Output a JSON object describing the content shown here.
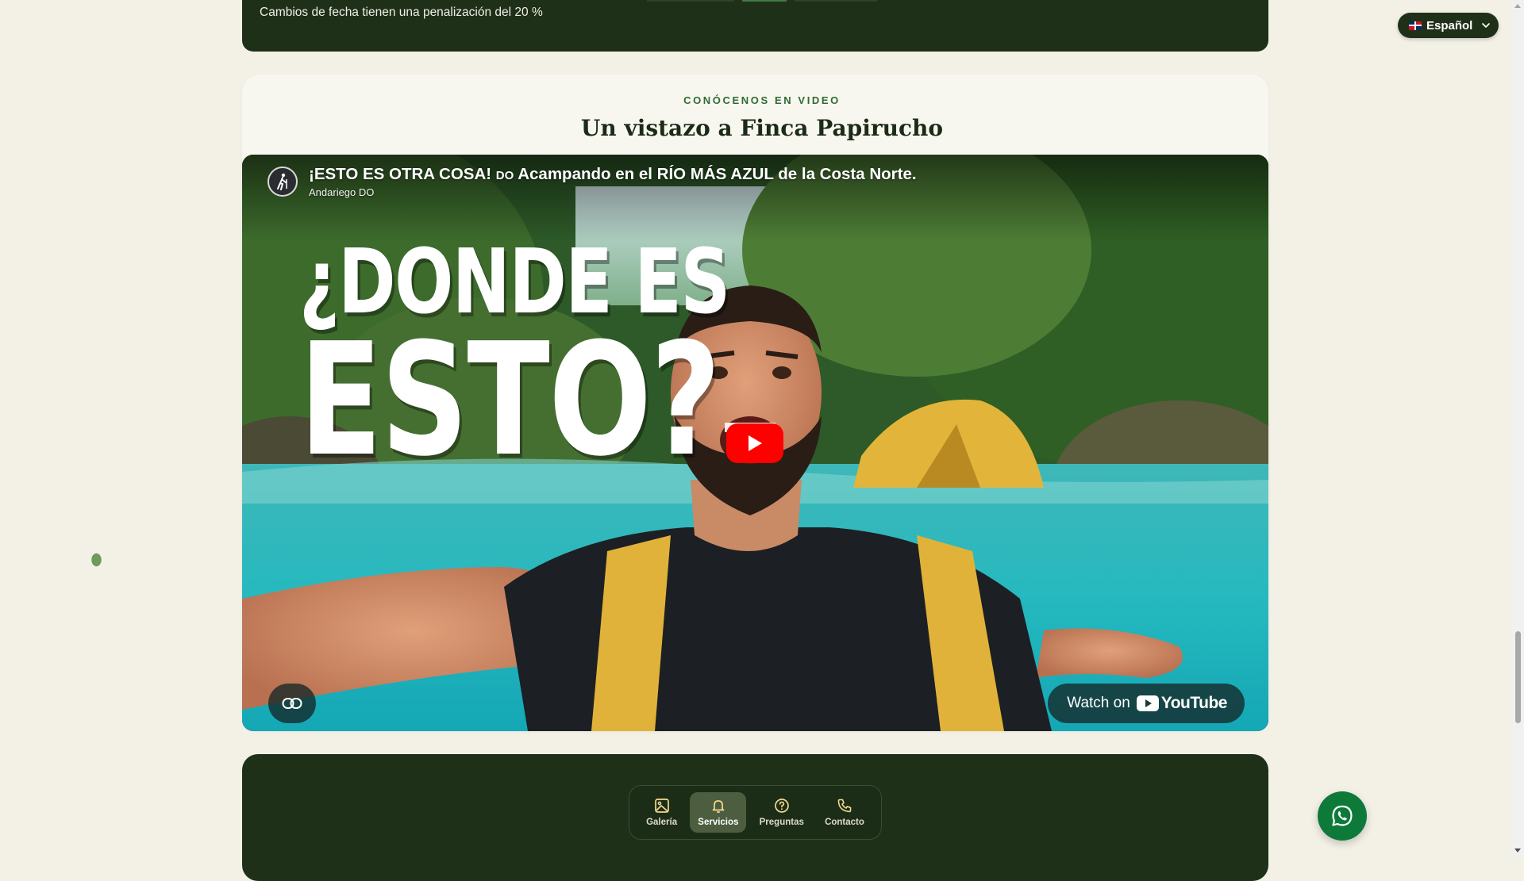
{
  "previous_section": {
    "note": "Cambios de fecha tienen una penalización del 20 %"
  },
  "video_section": {
    "eyebrow": "CONÓCENOS EN VIDEO",
    "title": "Un vistazo a Finca Papirucho"
  },
  "video": {
    "title_part1": "¡ESTO ES OTRA COSA! ",
    "title_flag": "DO",
    "title_part2": " Acampando en el RÍO MÁS AZUL de la Costa Norte.",
    "channel": "Andariego DO",
    "thumbnail_line1": "¿DONDE ES",
    "thumbnail_line2": "ESTO?",
    "watch_on_label": "Watch on",
    "youtube_word": "YouTube"
  },
  "bottom_nav": {
    "items": [
      {
        "label": "Galería",
        "icon": "image-icon"
      },
      {
        "label": "Servicios",
        "icon": "bell-icon",
        "active": true
      },
      {
        "label": "Preguntas",
        "icon": "question-icon"
      },
      {
        "label": "Contacto",
        "icon": "phone-icon"
      }
    ]
  },
  "language": {
    "selected": "Español"
  },
  "colors": {
    "forest_dark": "#1f3019",
    "page_bg": "#f3f1e6",
    "eyebrow_green": "#2f6a35",
    "youtube_red": "#ff0000",
    "whatsapp_green": "#0d7a3a"
  }
}
